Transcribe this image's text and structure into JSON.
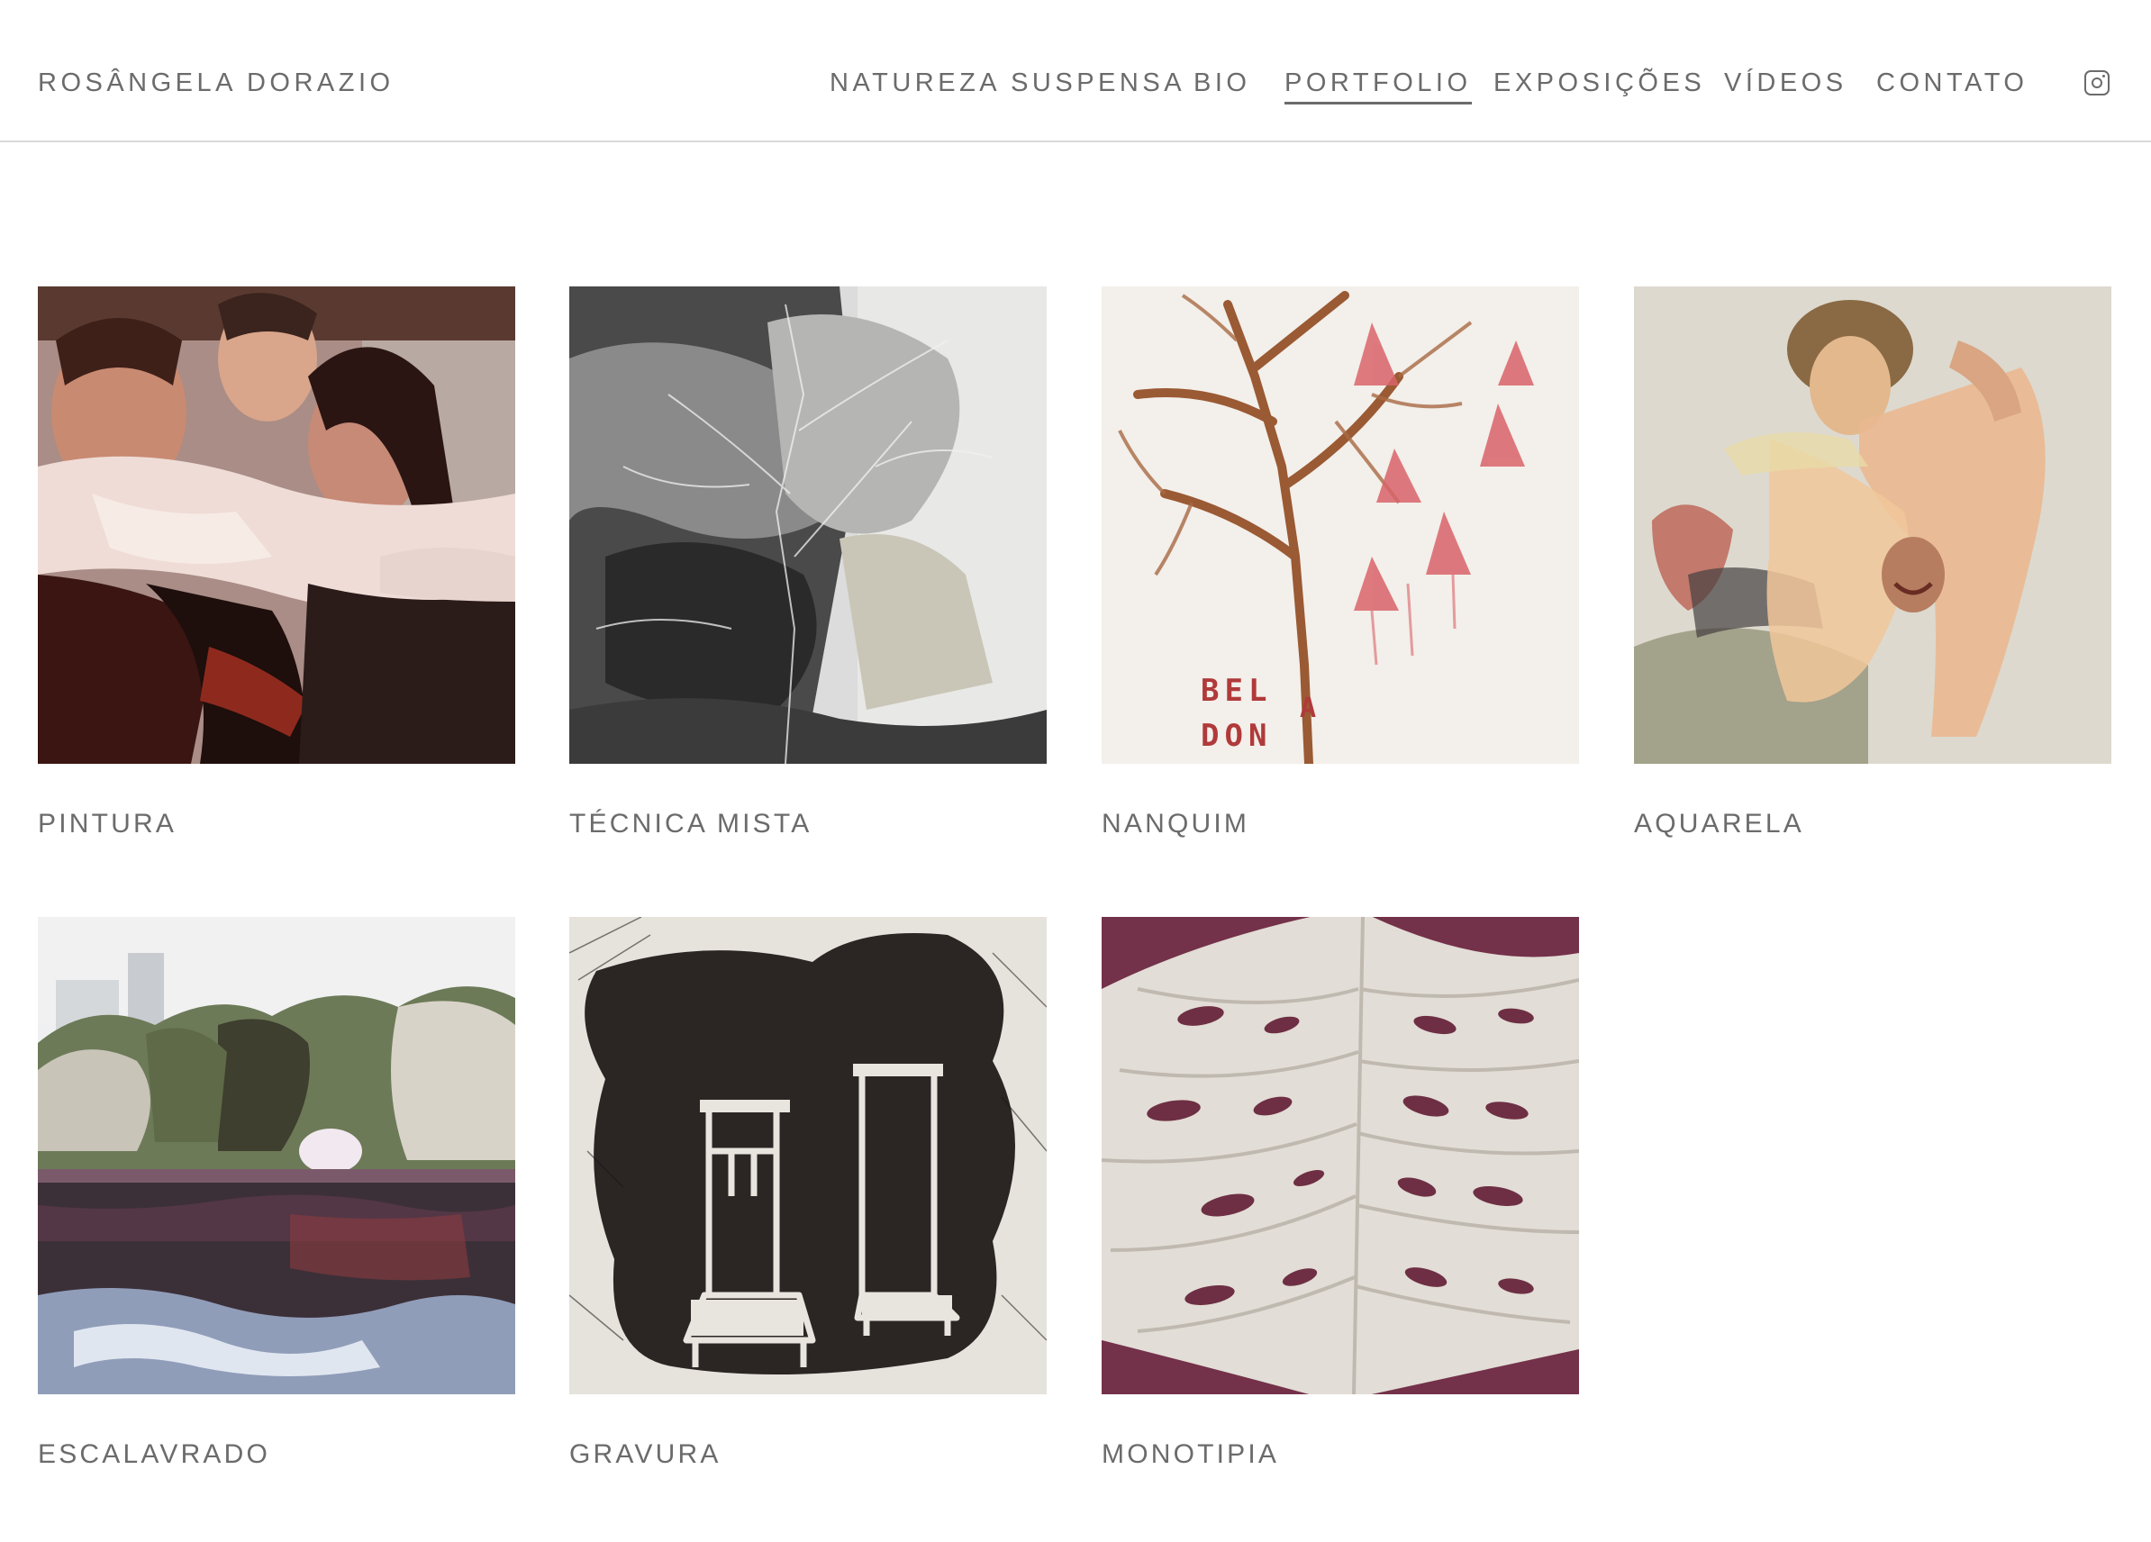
{
  "site": {
    "title": "ROSÂNGELA DORAZIO"
  },
  "nav": {
    "items": [
      {
        "label": "NATUREZA SUSPENSA",
        "active": false
      },
      {
        "label": "BIO",
        "active": false
      },
      {
        "label": "PORTFOLIO",
        "active": true
      },
      {
        "label": "EXPOSIÇÕES",
        "active": false
      },
      {
        "label": "VÍDEOS",
        "active": false
      },
      {
        "label": "CONTATO",
        "active": false
      }
    ],
    "social_icon": "instagram-icon"
  },
  "portfolio": {
    "categories": [
      {
        "label": "PINTURA",
        "image": "painting-of-embracing-figures"
      },
      {
        "label": "TÉCNICA MISTA",
        "image": "black-and-white-tree-landscape"
      },
      {
        "label": "NANQUIM",
        "image": "ink-tree-with-red-flowers"
      },
      {
        "label": "AQUARELA",
        "image": "watercolor-figures"
      },
      {
        "label": "ESCALAVRADO",
        "image": "lake-with-trees"
      },
      {
        "label": "GRAVURA",
        "image": "etching-two-chairs"
      },
      {
        "label": "MONOTIPIA",
        "image": "monotype-leaf"
      }
    ],
    "nanquim_text": [
      "BEL",
      "A",
      "DON",
      "A"
    ]
  }
}
